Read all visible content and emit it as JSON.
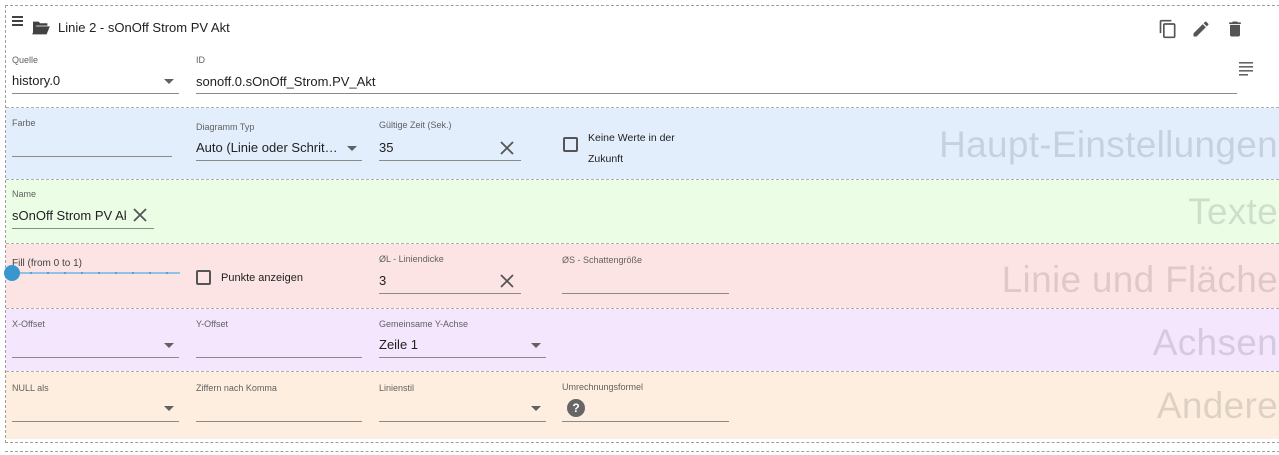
{
  "header": {
    "title": "Linie 2 - sOnOff Strom PV Akt",
    "icons": [
      "menu-icon",
      "folder-open-icon",
      "copy-icon",
      "edit-icon",
      "delete-icon",
      "notes-icon"
    ]
  },
  "source_row": {
    "quelle_label": "Quelle",
    "quelle_value": "history.0",
    "id_label": "ID",
    "id_value": "sonoff.0.sOnOff_Strom.PV_Akt"
  },
  "main_settings": {
    "title": "Haupt-Einstellungen",
    "farbe_label": "Farbe",
    "farbe_value": "",
    "diagram_type_label": "Diagramm Typ",
    "diagram_type_value": "Auto (Linie oder Schrit…",
    "valid_time_label": "Gültige Zeit (Sek.)",
    "valid_time_value": "35",
    "no_future_label_line1": "Keine Werte in der",
    "no_future_label_line2": "Zukunft",
    "no_future_checked": false
  },
  "texts": {
    "title": "Texte",
    "name_label": "Name",
    "name_value": "sOnOff Strom PV Akt"
  },
  "line_area": {
    "title": "Linie und Fläche",
    "fill_label": "Fill (from 0 to 1)",
    "fill_value": 0,
    "points_label": "Punkte anzeigen",
    "points_checked": false,
    "line_width_label": "ØL - Liniendicke",
    "line_width_value": "3",
    "shadow_label": "ØS - Schattengröße",
    "shadow_value": ""
  },
  "axes": {
    "title": "Achsen",
    "x_offset_label": "X-Offset",
    "y_offset_label": "Y-Offset",
    "common_y_label": "Gemeinsame Y-Achse",
    "common_y_value": "Zeile 1"
  },
  "other": {
    "title": "Andere",
    "null_as_label": "NULL als",
    "decimals_label": "Ziffern nach Komma",
    "line_style_label": "Linienstil",
    "conversion_label": "Umrechnungsformel",
    "help_glyph": "?"
  },
  "colors": {
    "main_bg": "#e3eefc",
    "texts_bg": "#ecfde6",
    "line_bg": "#fde4e4",
    "axes_bg": "#f3e6fd",
    "other_bg": "#fdeee0",
    "slider_accent": "#3a96cf"
  }
}
